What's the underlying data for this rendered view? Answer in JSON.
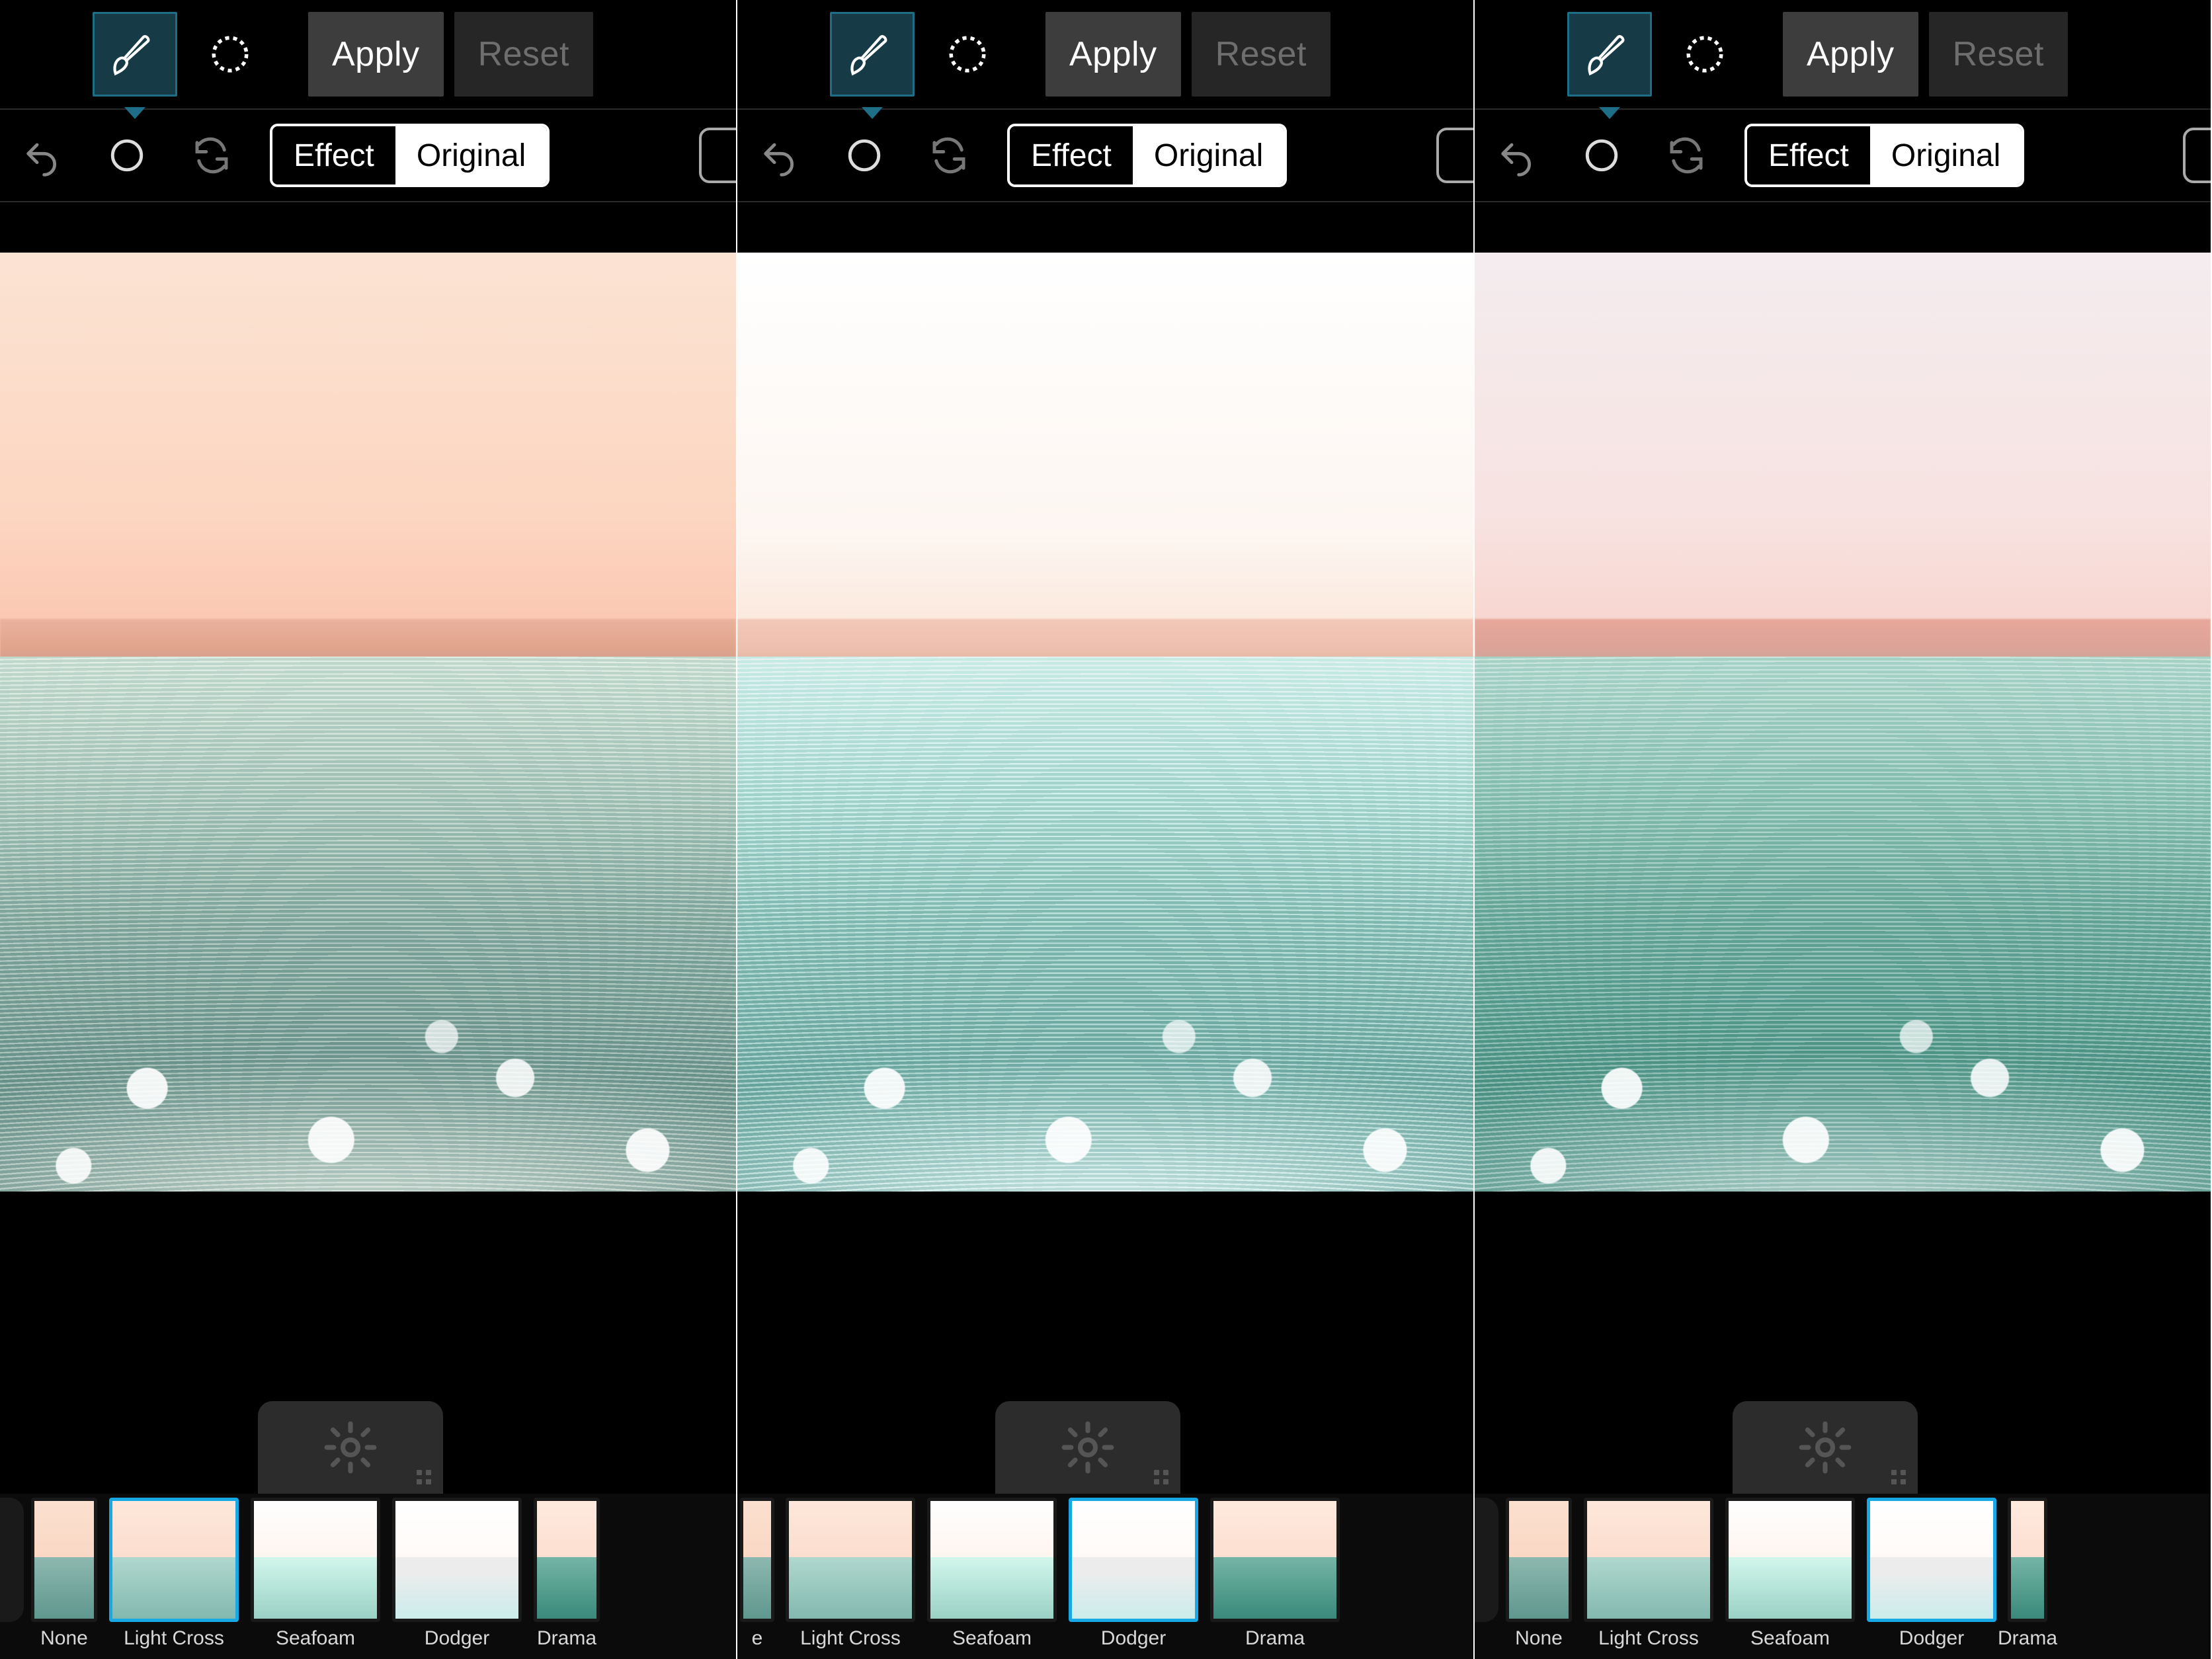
{
  "panels": [
    {
      "toolbar": {
        "apply": "Apply",
        "reset": "Reset"
      },
      "toggle": {
        "effect": "Effect",
        "original": "Original",
        "active": "original"
      },
      "selected_filter": "Light Cross",
      "filters": [
        {
          "key": "none",
          "label": "None"
        },
        {
          "key": "lc",
          "label": "Light Cross"
        },
        {
          "key": "sf",
          "label": "Seafoam"
        },
        {
          "key": "dg",
          "label": "Dodger"
        },
        {
          "key": "dr",
          "label": "Drama"
        }
      ]
    },
    {
      "toolbar": {
        "apply": "Apply",
        "reset": "Reset"
      },
      "toggle": {
        "effect": "Effect",
        "original": "Original",
        "active": "original"
      },
      "selected_filter": "Dodger",
      "filters": [
        {
          "key": "none",
          "label": "e"
        },
        {
          "key": "lc",
          "label": "Light Cross"
        },
        {
          "key": "sf",
          "label": "Seafoam"
        },
        {
          "key": "dg",
          "label": "Dodger"
        },
        {
          "key": "dr",
          "label": "Drama"
        }
      ]
    },
    {
      "toolbar": {
        "apply": "Apply",
        "reset": "Reset"
      },
      "toggle": {
        "effect": "Effect",
        "original": "Original",
        "active": "original"
      },
      "selected_filter": "Dodger",
      "filters": [
        {
          "key": "none",
          "label": "None"
        },
        {
          "key": "lc",
          "label": "Light Cross"
        },
        {
          "key": "sf",
          "label": "Seafoam"
        },
        {
          "key": "dg",
          "label": "Dodger"
        },
        {
          "key": "dr",
          "label": "Drama"
        }
      ]
    }
  ],
  "icons": {
    "brush": "brush-icon",
    "vignette": "vignette-icon",
    "undo": "undo-icon",
    "circle": "circle-icon",
    "refresh": "refresh-icon",
    "gear": "gear-icon"
  }
}
